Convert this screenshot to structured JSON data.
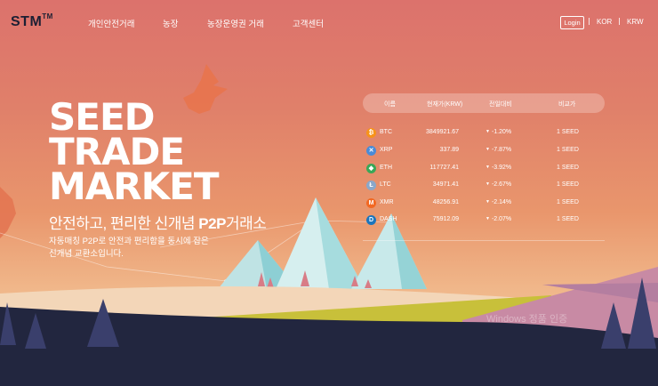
{
  "logo": {
    "text": "STM",
    "mark": "TM"
  },
  "nav": {
    "items": [
      "개인안전거래",
      "농장",
      "농장운영권 거래",
      "고객센터"
    ],
    "login": "Login",
    "language": "KOR",
    "currency": "KRW"
  },
  "hero": {
    "title_lines": [
      "SEED",
      "TRADE",
      "MARKET"
    ],
    "subtitle_pre": "안전하고, 편리한 신개념 ",
    "subtitle_bold": "P2P",
    "subtitle_post": "거래소",
    "desc_line1": "자동매칭 P2P로 안전과 편리함을 동시에 잡은",
    "desc_line2": "신개념 교환소입니다."
  },
  "table": {
    "headers": [
      "이름",
      "현재가(KRW)",
      "전일대비",
      "비교가"
    ],
    "rows": [
      {
        "icon": "bitcoin-icon",
        "icon_char": "₿",
        "color": "#f7931a",
        "symbol": "BTC",
        "price": "3849921.67",
        "change": "-1.20%",
        "compare": "1 SEED"
      },
      {
        "icon": "ripple-icon",
        "icon_char": "✕",
        "color": "#4a8bd6",
        "symbol": "XRP",
        "price": "337.89",
        "change": "-7.87%",
        "compare": "1 SEED"
      },
      {
        "icon": "ethereum-icon",
        "icon_char": "◆",
        "color": "#3aa757",
        "symbol": "ETH",
        "price": "117727.41",
        "change": "-3.92%",
        "compare": "1 SEED"
      },
      {
        "icon": "litecoin-icon",
        "icon_char": "Ł",
        "color": "#8aa7c9",
        "symbol": "LTC",
        "price": "34971.41",
        "change": "-2.67%",
        "compare": "1 SEED"
      },
      {
        "icon": "monero-icon",
        "icon_char": "M",
        "color": "#f26822",
        "symbol": "XMR",
        "price": "48256.91",
        "change": "-2.14%",
        "compare": "1 SEED"
      },
      {
        "icon": "dash-icon",
        "icon_char": "D",
        "color": "#1c75bc",
        "symbol": "DASH",
        "price": "75912.09",
        "change": "-2.07%",
        "compare": "1 SEED"
      }
    ]
  },
  "watermark": "Windows 정품 인증"
}
